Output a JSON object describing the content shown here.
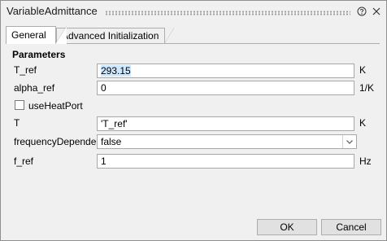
{
  "window": {
    "title": "VariableAdmittance"
  },
  "icons": {
    "help": "help-icon",
    "close": "close-icon",
    "dropdown": "chevron-down-icon"
  },
  "tabs": [
    {
      "label": "General",
      "active": true
    },
    {
      "label": "Advanced Initialization",
      "active": false
    }
  ],
  "parameters": {
    "group_title": "Parameters",
    "T_ref": {
      "label": "T_ref",
      "value": "293.15",
      "unit": "K"
    },
    "alpha_ref": {
      "label": "alpha_ref",
      "value": "0",
      "unit": "1/K"
    },
    "useHeatPort": {
      "label": "useHeatPort",
      "checked": false
    },
    "T": {
      "label": "T",
      "value": "'T_ref'",
      "unit": "K"
    },
    "frequencyDependent": {
      "label": "frequencyDependent",
      "value": "false"
    },
    "f_ref": {
      "label": "f_ref",
      "value": "1",
      "unit": "Hz"
    }
  },
  "buttons": {
    "ok": "OK",
    "cancel": "Cancel"
  },
  "colors": {
    "selection": "#cde8ff",
    "border": "#adadad",
    "background": "#f0f0f0"
  }
}
